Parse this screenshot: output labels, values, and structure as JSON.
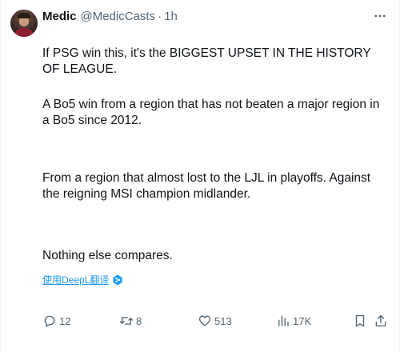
{
  "author": {
    "display_name": "Medic",
    "handle": "@MedicCasts",
    "separator": "·",
    "time": "1h"
  },
  "more_icon": "more-horizontal-icon",
  "body": {
    "paragraphs": [
      "If PSG win this, it's the BIGGEST UPSET IN THE HISTORY OF LEAGUE.",
      "A Bo5 win from a region that has not beaten a major region in a Bo5 since 2012.",
      "From a region that almost lost to the LJL in playoffs. Against the reigning MSI champion midlander.",
      "Nothing else compares."
    ]
  },
  "translate": {
    "label": "使用DeepL翻译",
    "icon": "deepl-icon"
  },
  "actions": {
    "reply": {
      "count": "12",
      "icon": "reply-icon"
    },
    "retweet": {
      "count": "8",
      "icon": "retweet-icon"
    },
    "like": {
      "count": "513",
      "icon": "heart-icon"
    },
    "views": {
      "count": "17K",
      "icon": "views-icon"
    },
    "bookmark": {
      "icon": "bookmark-icon"
    },
    "share": {
      "icon": "share-icon"
    }
  },
  "colors": {
    "text": "#0f1419",
    "muted": "#536471",
    "link": "#1d9bf0"
  }
}
